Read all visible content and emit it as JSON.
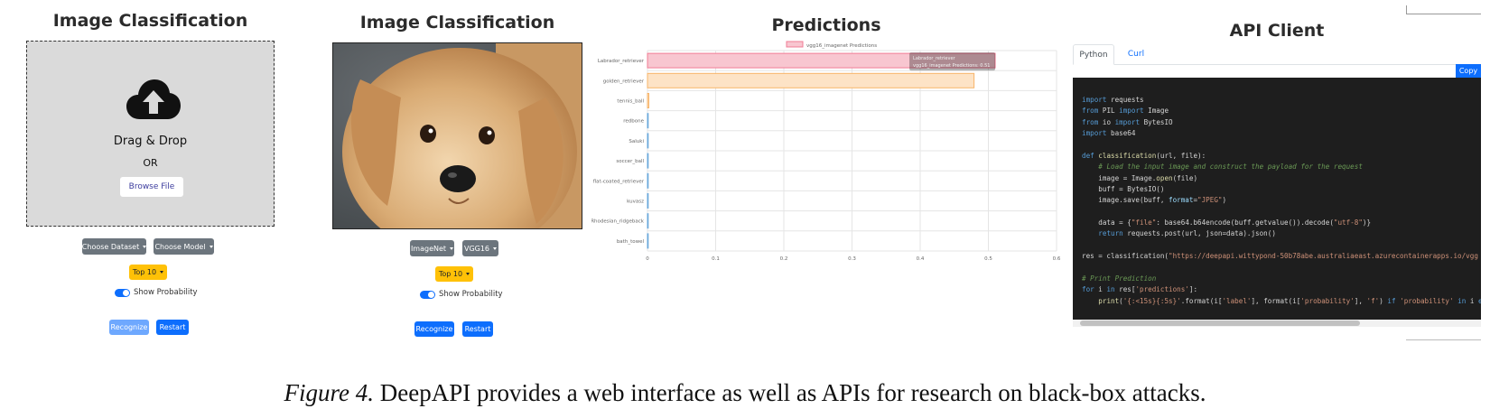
{
  "panel1": {
    "title": "Image Classification",
    "drag_text": "Drag & Drop",
    "or_text": "OR",
    "browse_label": "Browse File",
    "dataset_label": "Choose Dataset",
    "model_label": "Choose Model",
    "topk_label": "Top 10",
    "show_prob_label": "Show Probability",
    "recognize_label": "Recognize",
    "restart_label": "Restart",
    "upload_icon": "cloud-upload-icon"
  },
  "panel2": {
    "title": "Image Classification",
    "dataset_label": "ImageNet",
    "model_label": "VGG16",
    "topk_label": "Top 10",
    "show_prob_label": "Show Probability",
    "recognize_label": "Recognize",
    "restart_label": "Restart",
    "image": "puppy-photo"
  },
  "panel3": {
    "title": "Predictions"
  },
  "chart_data": {
    "type": "bar",
    "orientation": "horizontal",
    "legend": "vgg16_imagenet Predictions",
    "legend_position": "top",
    "categories": [
      "Labrador_retriever",
      "golden_retriever",
      "tennis_ball",
      "redbone",
      "Saluki",
      "soccer_ball",
      "flat-coated_retriever",
      "kuvasz",
      "Rhodesian_ridgeback",
      "bath_towel"
    ],
    "values": [
      0.51,
      0.479,
      0.002,
      0.001,
      0.001,
      0.001,
      0.0008,
      0.0006,
      0.0005,
      0.0004
    ],
    "xlim": [
      0,
      0.6
    ],
    "xticks": [
      "0",
      "0.1",
      "0.2",
      "0.3",
      "0.4",
      "0.5",
      "0.6"
    ],
    "grid": true,
    "tooltip": {
      "title": "Labrador_retriever",
      "body": "vgg16_imagenet Predictions: 0.51"
    },
    "colors": [
      "#f8c6d0",
      "#fde3c6",
      "#fde3c6",
      "#cfe3f5",
      "#cfe3f5",
      "#cfe3f5",
      "#cfe3f5",
      "#cfe3f5",
      "#cfe3f5",
      "#cfe3f5"
    ],
    "border_colors": [
      "#f17c95",
      "#f7b469",
      "#f7b469",
      "#6aa8db",
      "#6aa8db",
      "#6aa8db",
      "#6aa8db",
      "#6aa8db",
      "#6aa8db",
      "#6aa8db"
    ]
  },
  "panel4": {
    "title": "API Client",
    "tab_python": "Python",
    "tab_curl": "Curl",
    "copy_label": "Copy"
  },
  "caption": {
    "figure": "Figure 4.",
    "text": " DeepAPI provides a web interface as well as APIs for research on black-box attacks."
  },
  "colors": {
    "primary": "#0d6efd",
    "secondary": "#6c757d",
    "warning": "#ffc107",
    "dropzone": "#dadada",
    "code_bg": "#1e1e1e"
  }
}
